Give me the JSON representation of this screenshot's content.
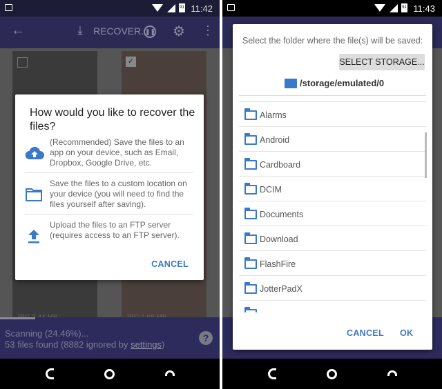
{
  "left": {
    "status": {
      "time": "11:42",
      "battery": "91"
    },
    "toolbar": {
      "recover_label": "RECOVER..."
    },
    "tiles": [
      {
        "caption": "JPG 2.44 MB"
      },
      {
        "caption": "JPG 1.98 MB"
      }
    ],
    "dialog": {
      "title": "How would you like to recover the files?",
      "options": [
        {
          "icon": "cloud-upload-icon",
          "text": "(Recommended) Save the files to an app on your device, such as Email, Dropbox, Google Drive, etc."
        },
        {
          "icon": "folder-icon",
          "text": "Save the files to a custom location on your device (you will need to find the files yourself after saving)."
        },
        {
          "icon": "upload-icon",
          "text": "Upload the files to an FTP server (requires access to an FTP server)."
        }
      ],
      "cancel": "CANCEL"
    },
    "bottom": {
      "scanning": "Scanning (24.46%)...",
      "found_prefix": "53 files found (8882 ignored by ",
      "settings_link": "settings",
      "found_suffix": ")",
      "progress_percent": 24.46
    }
  },
  "right": {
    "status": {
      "time": "11:43",
      "battery": "91"
    },
    "dialog": {
      "message": "Select the folder where the file(s) will be saved:",
      "select_storage": "SELECT STORAGE...",
      "path": "/storage/emulated/0",
      "folders": [
        "Alarms",
        "Android",
        "Cardboard",
        "DCIM",
        "Documents",
        "Download",
        "FlashFire",
        "JotterPadX",
        ""
      ],
      "cancel": "CANCEL",
      "ok": "OK"
    }
  },
  "colors": {
    "accent": "#3a78c9",
    "toolbar": "#2c2a55"
  }
}
